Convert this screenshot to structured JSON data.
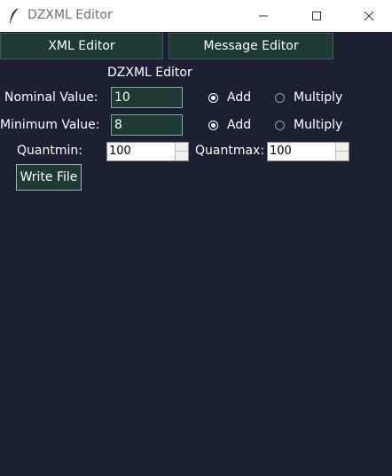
{
  "window": {
    "title": "DZXML Editor"
  },
  "tabs": {
    "xml_editor": "XML Editor",
    "message_editor": "Message Editor"
  },
  "form": {
    "heading": "DZXML Editor",
    "nominal": {
      "label": "Nominal Value:",
      "value": "10",
      "add_label": "Add",
      "multiply_label": "Multiply",
      "selected": "Add"
    },
    "minimum": {
      "label": "Minimum Value:",
      "value": "8",
      "add_label": "Add",
      "multiply_label": "Multiply",
      "selected": "Add"
    },
    "quantmin": {
      "label": "Quantmin:",
      "value": "100"
    },
    "quantmax": {
      "label": "Quantmax:",
      "value": "100"
    },
    "write_button": "Write File"
  },
  "colors": {
    "background": "#1b2033",
    "widget": "#1f3a35"
  }
}
